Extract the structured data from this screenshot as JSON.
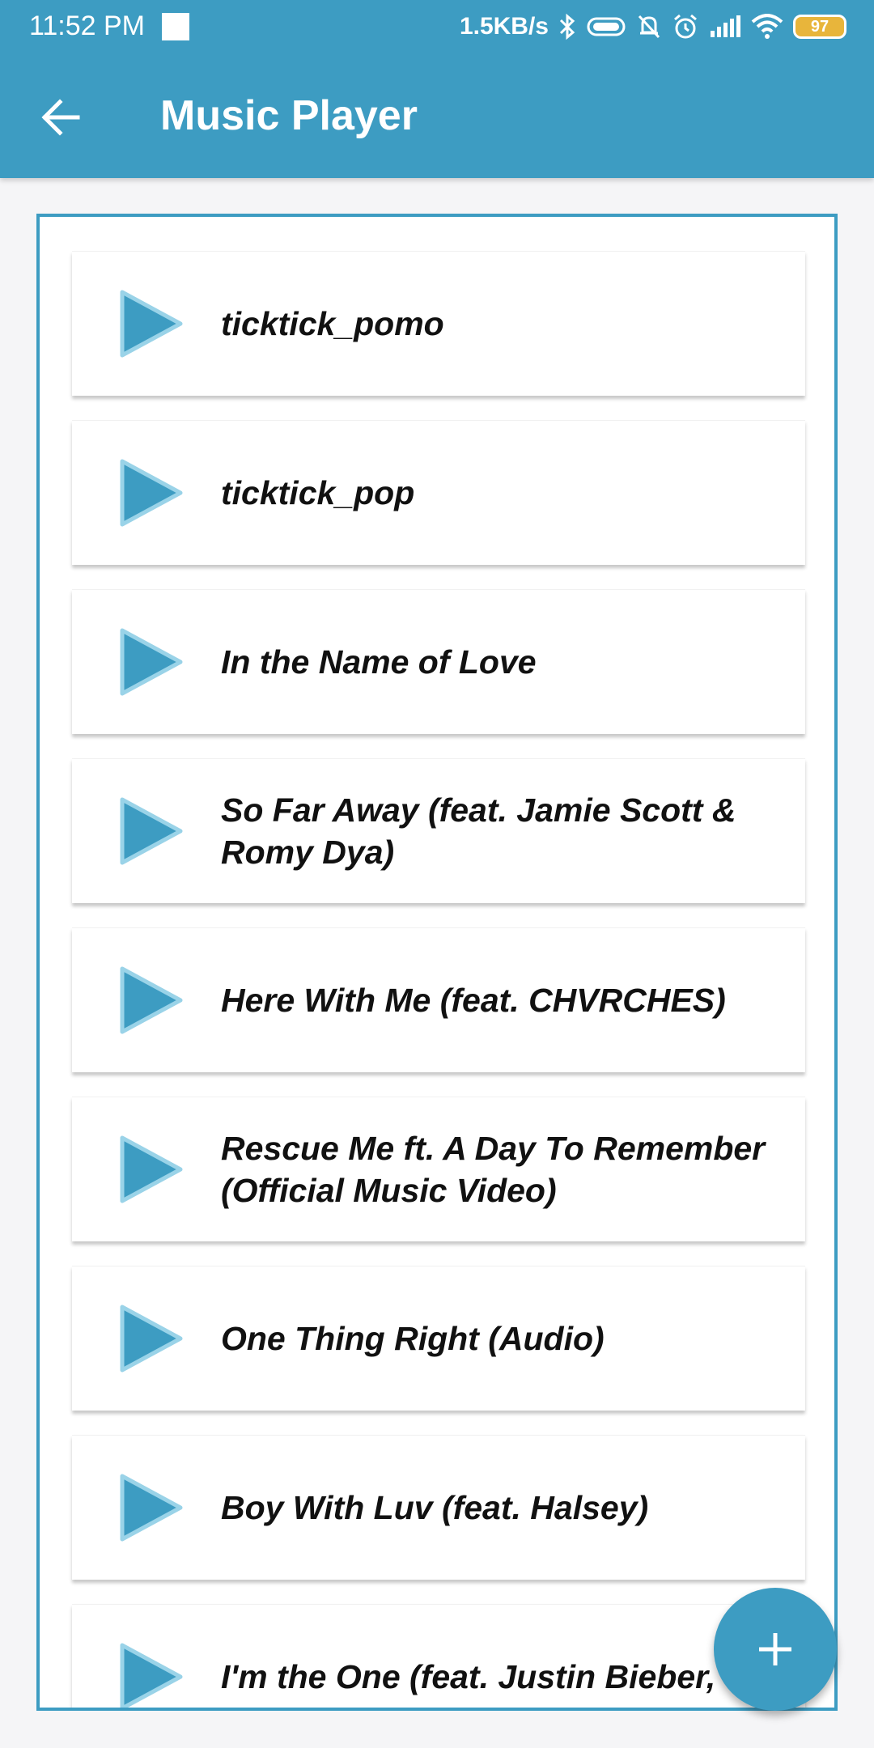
{
  "status_bar": {
    "time": "11:52 PM",
    "net_speed": "1.5KB/s",
    "battery_level": "97",
    "icons": [
      "bluetooth-icon",
      "vibrate-icon",
      "mute-bell-icon",
      "alarm-icon",
      "signal-icon",
      "wifi-icon",
      "battery-icon"
    ]
  },
  "app_bar": {
    "title": "Music Player",
    "back_icon": "arrow-left-icon"
  },
  "songs": [
    {
      "title": "ticktick_pomo"
    },
    {
      "title": "ticktick_pop"
    },
    {
      "title": "In the Name of Love"
    },
    {
      "title": "So Far Away (feat. Jamie Scott & Romy Dya)"
    },
    {
      "title": "Here With Me (feat. CHVRCHES)"
    },
    {
      "title": "Rescue Me ft. A Day To Remember (Official Music Video)"
    },
    {
      "title": "One Thing Right (Audio)"
    },
    {
      "title": "Boy With Luv (feat. Halsey)"
    },
    {
      "title": "I'm the One (feat. Justin Bieber,"
    }
  ],
  "fab": {
    "icon": "plus-icon"
  },
  "colors": {
    "primary": "#3d9cc2",
    "battery": "#e8b53b"
  }
}
